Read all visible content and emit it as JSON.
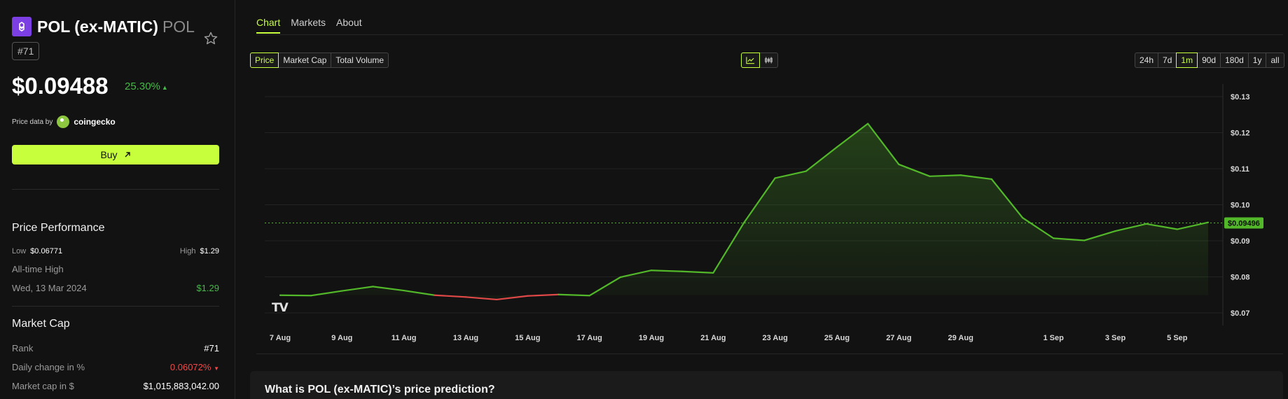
{
  "coin": {
    "name": "POL (ex-MATIC)",
    "symbol": "POL",
    "rank_badge": "#71",
    "price": "$0.09488",
    "change": "25.30%",
    "change_arrow": "▲",
    "price_data_by": "Price data by",
    "provider": "coingecko",
    "buy_label": "Buy",
    "buy_icon": "arrow-up-right-icon",
    "favorite_icon": "star-icon"
  },
  "performance": {
    "title": "Price Performance",
    "low_label": "Low",
    "low_value": "$0.06771",
    "high_label": "High",
    "high_value": "$1.29",
    "ath_label": "All-time High",
    "ath_date": "Wed, 13 Mar 2024",
    "ath_value": "$1.29"
  },
  "market_cap": {
    "title": "Market Cap",
    "rows": [
      {
        "label": "Rank",
        "value": "#71"
      },
      {
        "label": "Daily change in %",
        "value": "0.06072%",
        "arrow": "▼"
      },
      {
        "label": "Market cap in $",
        "value": "$1,015,883,042.00"
      }
    ]
  },
  "tabs": [
    "Chart",
    "Markets",
    "About"
  ],
  "metric_buttons": [
    "Price",
    "Market Cap",
    "Total Volume"
  ],
  "chart_style_icons": [
    "line-chart-icon",
    "candlestick-icon"
  ],
  "range_buttons": [
    "24h",
    "7d",
    "1m",
    "90d",
    "180d",
    "1y",
    "all"
  ],
  "active_range": "1m",
  "chart_data": {
    "type": "line",
    "x": [
      "7 Aug",
      "8 Aug",
      "9 Aug",
      "10 Aug",
      "11 Aug",
      "12 Aug",
      "13 Aug",
      "14 Aug",
      "15 Aug",
      "16 Aug",
      "17 Aug",
      "18 Aug",
      "19 Aug",
      "20 Aug",
      "21 Aug",
      "22 Aug",
      "23 Aug",
      "24 Aug",
      "25 Aug",
      "26 Aug",
      "27 Aug",
      "28 Aug",
      "29 Aug",
      "30 Aug",
      "31 Aug",
      "1 Sep",
      "2 Sep",
      "3 Sep",
      "4 Sep",
      "5 Sep",
      "6 Sep"
    ],
    "values": [
      0.0749,
      0.0748,
      0.0761,
      0.0773,
      0.0762,
      0.0749,
      0.0744,
      0.0737,
      0.0747,
      0.0751,
      0.0748,
      0.0799,
      0.0818,
      0.0815,
      0.0811,
      0.0951,
      0.1074,
      0.1093,
      0.116,
      0.1225,
      0.1112,
      0.1079,
      0.1082,
      0.1071,
      0.0964,
      0.0907,
      0.0901,
      0.0927,
      0.0947,
      0.0932,
      0.0951
    ],
    "x_tick_labels": [
      "7 Aug",
      "9 Aug",
      "11 Aug",
      "13 Aug",
      "15 Aug",
      "17 Aug",
      "19 Aug",
      "21 Aug",
      "23 Aug",
      "25 Aug",
      "27 Aug",
      "29 Aug",
      "1 Sep",
      "3 Sep",
      "5 Sep"
    ],
    "y_ticks": [
      0.07,
      0.08,
      0.09,
      0.1,
      0.11,
      0.12,
      0.13
    ],
    "y_tick_labels": [
      "$0.07",
      "$0.08",
      "$0.09",
      "$0.10",
      "$0.11",
      "$0.12",
      "$0.13"
    ],
    "ylim": [
      0.0665,
      0.1335
    ],
    "current_value": 0.09496,
    "current_label": "$0.09496",
    "grid": true,
    "line_color": "#52b82a",
    "down_color": "#e04848",
    "watermark": "TV"
  },
  "prediction_title": "What is POL (ex-MATIC)’s price prediction?"
}
